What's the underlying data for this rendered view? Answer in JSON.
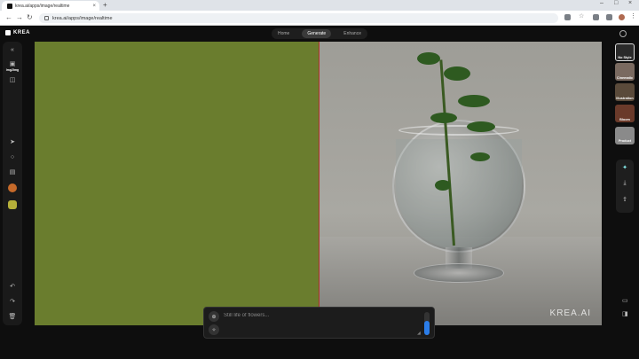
{
  "browser": {
    "tab_title": "krea.ai/apps/image/realtime",
    "address": "krea.ai/apps/image/realtime"
  },
  "app": {
    "logo": "KREA",
    "modes": [
      "Home",
      "Generate",
      "Enhance"
    ],
    "active_mode": "Generate"
  },
  "left_toolbar": {
    "image_tool_label": "Img2Img"
  },
  "styles": [
    {
      "label": "No Style",
      "color": "#2a2a2a"
    },
    {
      "label": "Cinematic",
      "color": "#7a6a60"
    },
    {
      "label": "Illustration",
      "color": "#5a4a3a"
    },
    {
      "label": "Bloom",
      "color": "#6a3a2a"
    },
    {
      "label": "Product",
      "color": "#8a8a8a"
    }
  ],
  "canvas": {
    "fill_color": "#6a7d2e",
    "divider_color": "#b0302a"
  },
  "prompt": {
    "placeholder": "Still life of flowers...",
    "strength": 0.6
  },
  "watermark": "KREA.AI",
  "accent": "#2b7de9"
}
